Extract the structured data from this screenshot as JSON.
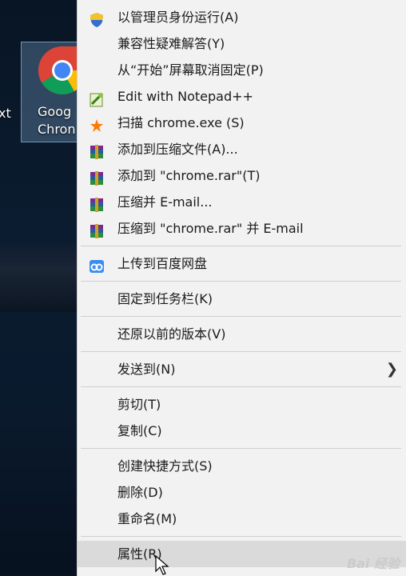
{
  "desktop": {
    "left_text": "xt",
    "icon_label": "Goog\nChron"
  },
  "menu": {
    "groups": [
      [
        {
          "label": "以管理员身份运行(A)",
          "icon": "uac-shield-icon"
        },
        {
          "label": "兼容性疑难解答(Y)",
          "icon": ""
        },
        {
          "label": "从“开始”屏幕取消固定(P)",
          "icon": ""
        },
        {
          "label": "Edit with Notepad++",
          "icon": "notepad-plus-icon"
        },
        {
          "label": "扫描 chrome.exe (S)",
          "icon": "avast-icon"
        },
        {
          "label": "添加到压缩文件(A)...",
          "icon": "winrar-icon"
        },
        {
          "label": "添加到 \"chrome.rar\"(T)",
          "icon": "winrar-icon"
        },
        {
          "label": "压缩并 E-mail...",
          "icon": "winrar-icon"
        },
        {
          "label": "压缩到 \"chrome.rar\" 并 E-mail",
          "icon": "winrar-icon"
        }
      ],
      [
        {
          "label": "上传到百度网盘",
          "icon": "baidu-cloud-icon"
        }
      ],
      [
        {
          "label": "固定到任务栏(K)",
          "icon": ""
        }
      ],
      [
        {
          "label": "还原以前的版本(V)",
          "icon": ""
        }
      ],
      [
        {
          "label": "发送到(N)",
          "icon": "",
          "submenu": true
        }
      ],
      [
        {
          "label": "剪切(T)",
          "icon": ""
        },
        {
          "label": "复制(C)",
          "icon": ""
        }
      ],
      [
        {
          "label": "创建快捷方式(S)",
          "icon": ""
        },
        {
          "label": "删除(D)",
          "icon": ""
        },
        {
          "label": "重命名(M)",
          "icon": ""
        }
      ],
      [
        {
          "label": "属性(R)",
          "icon": "",
          "hovered": true
        }
      ]
    ]
  },
  "watermark": "Bai 经验",
  "colors": {
    "menu_bg": "#f2f2f2",
    "hover_bg": "#dadada",
    "separator": "#cfcfcf"
  }
}
